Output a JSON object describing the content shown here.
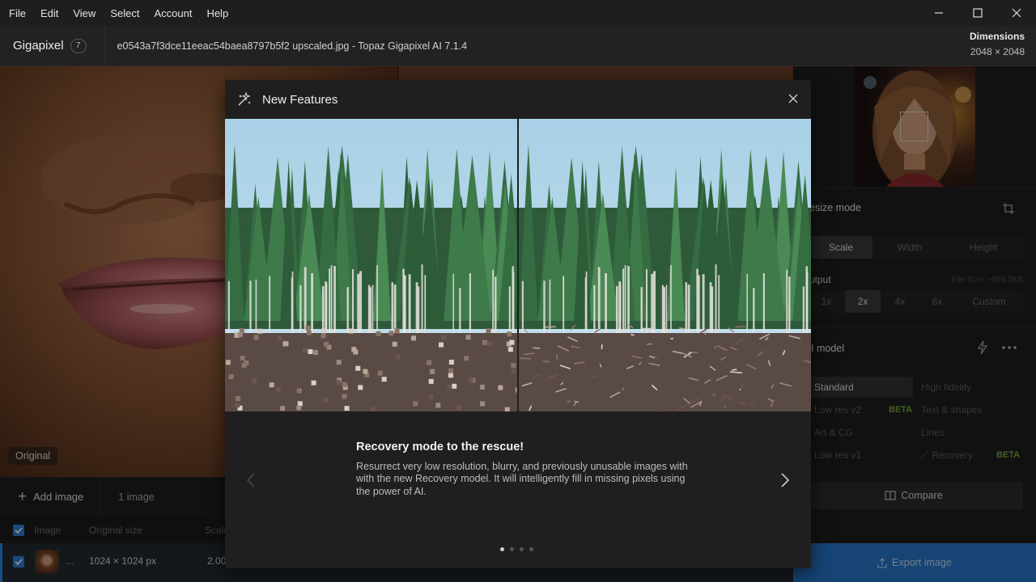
{
  "menu": {
    "items": [
      "File",
      "Edit",
      "View",
      "Select",
      "Account",
      "Help"
    ]
  },
  "titlebar": {
    "app_name": "Gigapixel",
    "badge": "7",
    "file_title": "e0543a7f3dce11eeac54baea8797b5f2 upscaled.jpg - Topaz Gigapixel AI 7.1.4",
    "dimensions_label": "Dimensions",
    "dimensions_value": "2048 × 2048"
  },
  "preview": {
    "original_label": "Original"
  },
  "bottombar": {
    "add_image": "Add image",
    "image_count": "1 image"
  },
  "table": {
    "headers": [
      "Image",
      "Original size",
      "Scale"
    ],
    "row": {
      "name": "...",
      "original_size": "1024 × 1024 px",
      "scale": "2.00"
    }
  },
  "rpanel": {
    "resize_mode_title": "esize mode",
    "resize_tabs": [
      "Scale",
      "Width",
      "Height"
    ],
    "output_title": "utput",
    "file_size": "File Size: ~909.3KB",
    "scales": [
      "1x",
      "2x",
      "4x",
      "6x",
      "Custom"
    ],
    "ai_model_title": "I model",
    "models": {
      "standard": "Standard",
      "high_fidelity": "High fidelity",
      "low_res_v2": "Low res v2",
      "text_shapes": "Text & shapes",
      "art_cg": "Art & CG",
      "lines": "Lines",
      "low_res_v1": "Low res v1",
      "recovery": "Recovery"
    },
    "beta": "BETA",
    "compare": "Compare",
    "export": "Export image"
  },
  "modal": {
    "title": "New Features",
    "heading": "Recovery mode to the rescue!",
    "body": "Resurrect very low resolution, blurry, and previously unusable images with with the new Recovery model. It will intelligently fill in missing pixels using the power of AI.",
    "page_count": 4,
    "active_page": 1
  },
  "colors": {
    "accent": "#2676c9",
    "beta": "#77a93b",
    "background": "#1b1b1b"
  }
}
